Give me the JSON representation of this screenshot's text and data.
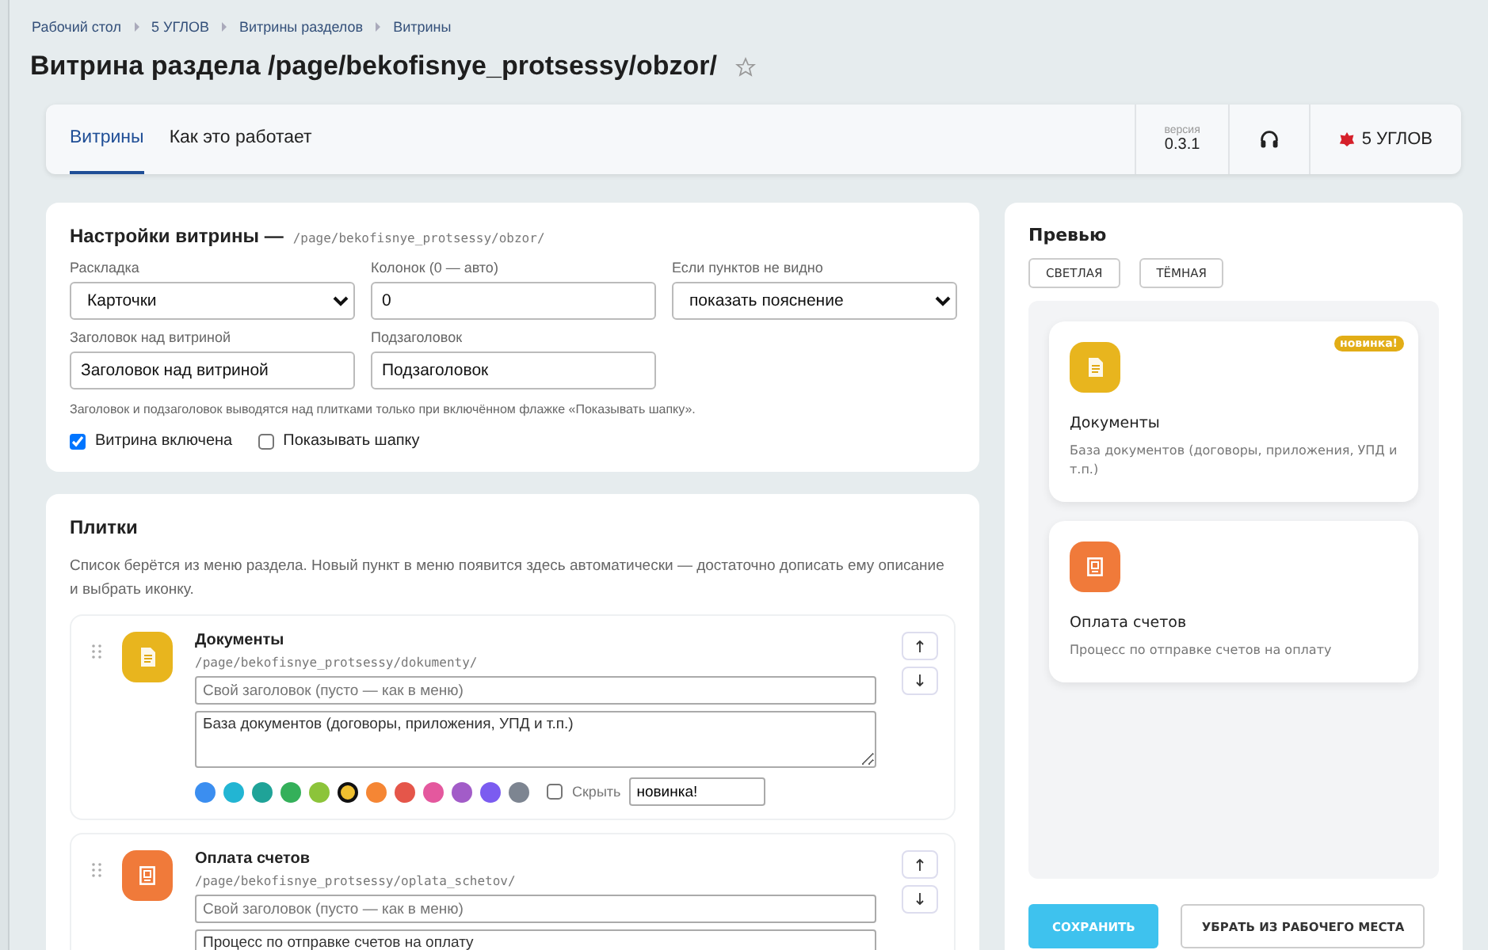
{
  "breadcrumbs": [
    "Рабочий стол",
    "5 УГЛОВ",
    "Витрины разделов",
    "Витрины"
  ],
  "page_title": "Витрина раздела /page/bekofisnye_protsessy/obzor/",
  "favorite": false,
  "tabs": [
    {
      "label": "Витрины",
      "selected": true
    },
    {
      "label": "Как это работает",
      "selected": false
    }
  ],
  "header_right": {
    "version_label": "версия",
    "version": "0.3.1",
    "brand": "5 УГЛОВ"
  },
  "settings": {
    "title": "Настройки витрины —",
    "path": "/page/bekofisnye_protsessy/obzor/",
    "fields": [
      {
        "kind": "select",
        "label": "Раскладка",
        "value": "Карточки"
      },
      {
        "kind": "input",
        "label": "Колонок (0 — авто)",
        "value": "0"
      },
      {
        "kind": "select",
        "label": "Если пунктов не видно",
        "value": "показать пояснение"
      },
      {
        "kind": "input",
        "label": "Заголовок над витриной",
        "value": "Заголовок над витриной"
      },
      {
        "kind": "input",
        "label": "Подзаголовок",
        "value": "Подзаголовок"
      }
    ],
    "hint": "Заголовок и подзаголовок выводятся над плитками только при включённом флажке «Показывать шапку».",
    "checkboxes": [
      {
        "label": "Витрина включена",
        "checked": true
      },
      {
        "label": "Показывать шапку",
        "checked": false
      }
    ]
  },
  "tiles": {
    "title": "Плитки",
    "description": "Список берётся из меню раздела. Новый пункт в меню появится здесь автоматически — достаточно дописать ему описание и выбрать иконку.",
    "items": [
      {
        "name": "Документы",
        "path": "/page/bekofisnye_protsessy/dokumenty/",
        "color": "#e8b51e",
        "title_placeholder": "Свой заголовок (пусто — как в меню)",
        "description": "База документов (договоры, приложения, УПД и т.п.)",
        "swatches": [
          {
            "color": "#3b8ef0",
            "selected": false
          },
          {
            "color": "#22b5d3",
            "selected": false
          },
          {
            "color": "#1fa398",
            "selected": false
          },
          {
            "color": "#34b05a",
            "selected": false
          },
          {
            "color": "#8cc43a",
            "selected": false
          },
          {
            "color": "#f0c030",
            "selected": true
          },
          {
            "color": "#f58634",
            "selected": false
          },
          {
            "color": "#e5564a",
            "selected": false
          },
          {
            "color": "#e4589e",
            "selected": false
          },
          {
            "color": "#a25cc8",
            "selected": false
          },
          {
            "color": "#7b5cf0",
            "selected": false
          },
          {
            "color": "#7d8591",
            "selected": false
          }
        ],
        "hide_label": "Скрыть",
        "hidden": false,
        "badge": "новинка!"
      },
      {
        "name": "Оплата счетов",
        "path": "/page/bekofisnye_protsessy/oplata_schetov/",
        "color": "#f07a3a",
        "title_placeholder": "Свой заголовок (пусто — как в меню)",
        "description": "Процесс по отправке счетов на оплату"
      }
    ]
  },
  "preview": {
    "title": "Превью",
    "themes": [
      {
        "label": "СВЕТЛАЯ",
        "selected": false
      },
      {
        "label": "ТЁМНАЯ",
        "selected": false
      }
    ],
    "cards": [
      {
        "title": "Документы",
        "text": "База документов (договоры, приложения, УПД и т.п.)",
        "color": "#e8b51e",
        "badge": "новинка!"
      },
      {
        "title": "Оплата счетов",
        "text": "Процесс по отправке счетов на оплату",
        "color": "#f07a3a"
      }
    ]
  },
  "actions": [
    {
      "kind": "primary",
      "label": "СОХРАНИТЬ"
    },
    {
      "kind": "secondary",
      "label": "УБРАТЬ ИЗ РАБОЧЕГО МЕСТА"
    }
  ]
}
